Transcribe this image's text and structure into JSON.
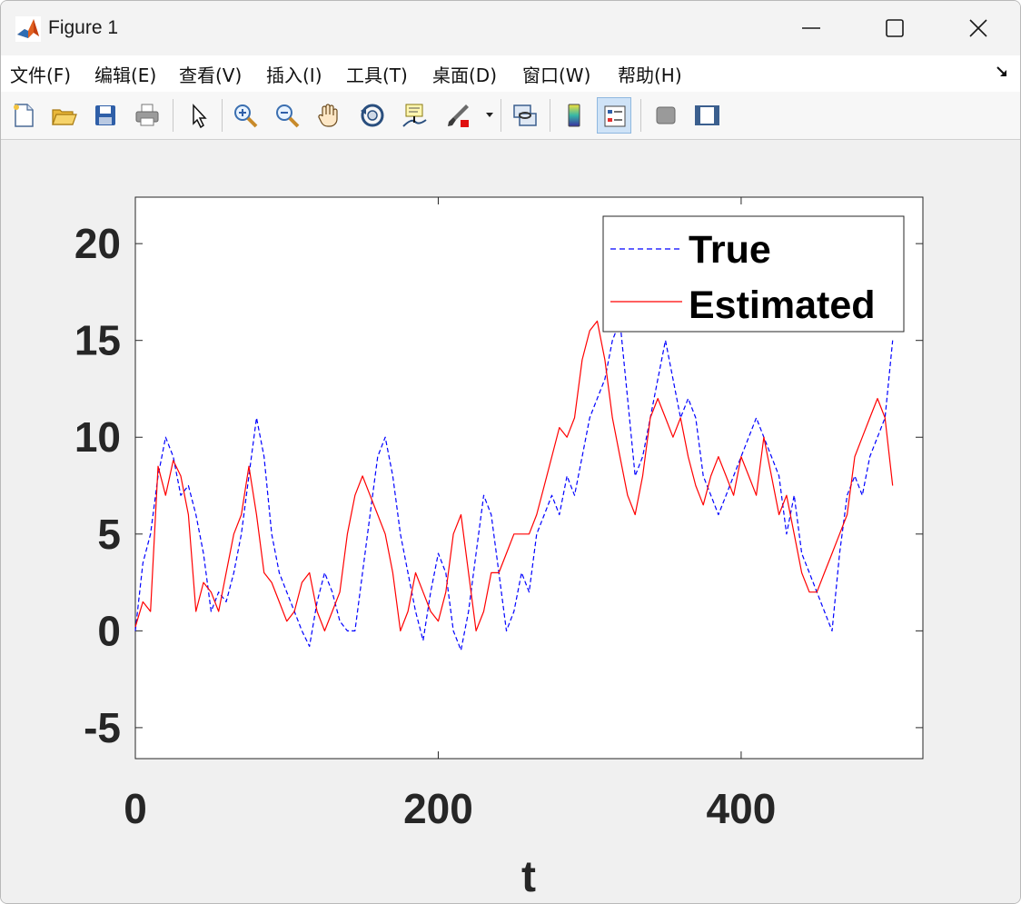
{
  "window": {
    "title": "Figure 1",
    "icon": "matlab-logo-icon",
    "controls": [
      "minimize-icon",
      "maximize-icon",
      "close-icon"
    ]
  },
  "menu": {
    "items": [
      "文件(F)",
      "编辑(E)",
      "查看(V)",
      "插入(I)",
      "工具(T)",
      "桌面(D)",
      "窗口(W)",
      "帮助(H)"
    ]
  },
  "toolbar": {
    "buttons": [
      "new-figure-icon",
      "open-file-icon",
      "save-icon",
      "print-icon",
      "edit-plot-cursor-icon",
      "zoom-in-icon",
      "zoom-out-icon",
      "pan-hand-icon",
      "rotate-3d-icon",
      "data-cursor-icon",
      "brush-icon",
      "link-plot-icon",
      "insert-colorbar-icon",
      "insert-legend-icon",
      "hide-plot-tools-icon",
      "show-plot-tools-icon"
    ],
    "pressed": "insert-legend-icon"
  },
  "colors": {
    "true_series": "#0000ff",
    "estimated_series": "#ff0000"
  },
  "chart_data": {
    "type": "line",
    "title": "",
    "xlabel": "t",
    "ylabel": "",
    "xlim": [
      0,
      520
    ],
    "ylim": [
      -6.6,
      22.4
    ],
    "xticks": [
      0,
      200,
      400
    ],
    "yticks": [
      -5,
      0,
      5,
      10,
      15,
      20
    ],
    "xtick_labels": [
      "0",
      "200",
      "400"
    ],
    "ytick_labels": [
      "-5",
      "0",
      "5",
      "10",
      "15",
      "20"
    ],
    "grid": false,
    "legend": {
      "placement": "top-right",
      "entries": [
        "True",
        "Estimated"
      ]
    },
    "x": [
      0,
      5,
      10,
      15,
      20,
      25,
      30,
      35,
      40,
      45,
      50,
      55,
      60,
      65,
      70,
      75,
      80,
      85,
      90,
      95,
      100,
      105,
      110,
      115,
      120,
      125,
      130,
      135,
      140,
      145,
      150,
      155,
      160,
      165,
      170,
      175,
      180,
      185,
      190,
      195,
      200,
      205,
      210,
      215,
      220,
      225,
      230,
      235,
      240,
      245,
      250,
      255,
      260,
      265,
      270,
      275,
      280,
      285,
      290,
      295,
      300,
      305,
      310,
      315,
      320,
      325,
      330,
      335,
      340,
      345,
      350,
      355,
      360,
      365,
      370,
      375,
      380,
      385,
      390,
      395,
      400,
      405,
      410,
      415,
      420,
      425,
      430,
      435,
      440,
      445,
      450,
      455,
      460,
      465,
      470,
      475,
      480,
      485,
      490,
      495,
      500
    ],
    "series": [
      {
        "name": "True",
        "style": "dashed",
        "values": [
          0,
          3.5,
          5,
          8,
          10,
          9,
          7,
          7.5,
          6,
          4,
          1,
          2,
          1.5,
          3,
          5,
          8,
          11,
          9,
          5,
          3,
          2,
          1,
          0,
          -0.8,
          1.5,
          3,
          2,
          0.5,
          0,
          0,
          3,
          6,
          9,
          10,
          8,
          5,
          3,
          1,
          -0.5,
          2,
          4,
          3,
          0,
          -1,
          1,
          4,
          7,
          6,
          3,
          0,
          1,
          3,
          2,
          5,
          6,
          7,
          6,
          8,
          7,
          9,
          11,
          12,
          13,
          15,
          16,
          12,
          8,
          9,
          11,
          13,
          15,
          13,
          11,
          12,
          11,
          8,
          7,
          6,
          7,
          8,
          9,
          10,
          11,
          10,
          9,
          8,
          5,
          7,
          4,
          3,
          2,
          1,
          0,
          4,
          7,
          8,
          7,
          9,
          10,
          11,
          15
        ]
      },
      {
        "name": "Estimated",
        "style": "solid",
        "values": [
          0.2,
          1.5,
          1,
          8.5,
          7,
          8.8,
          8,
          6,
          1,
          2.5,
          2,
          1,
          3,
          5,
          6,
          8.5,
          6,
          3,
          2.5,
          1.5,
          0.5,
          1,
          2.5,
          3,
          1,
          0,
          1,
          2,
          5,
          7,
          8,
          7,
          6,
          5,
          3,
          0,
          1,
          3,
          2,
          1,
          0.5,
          2,
          5,
          6,
          3,
          0,
          1,
          3,
          3,
          4,
          5,
          5,
          5,
          6,
          7.5,
          9,
          10.5,
          10,
          11,
          14,
          15.5,
          16,
          14,
          11,
          9,
          7,
          6,
          8,
          11,
          12,
          11,
          10,
          11,
          9,
          7.5,
          6.5,
          8,
          9,
          8,
          7,
          9,
          8,
          7,
          10,
          8,
          6,
          7,
          5,
          3,
          2,
          2,
          3,
          4,
          5,
          6,
          9,
          10,
          11,
          12,
          11,
          7.5
        ]
      }
    ]
  },
  "legend_labels": {
    "true": "True",
    "estimated": "Estimated"
  }
}
